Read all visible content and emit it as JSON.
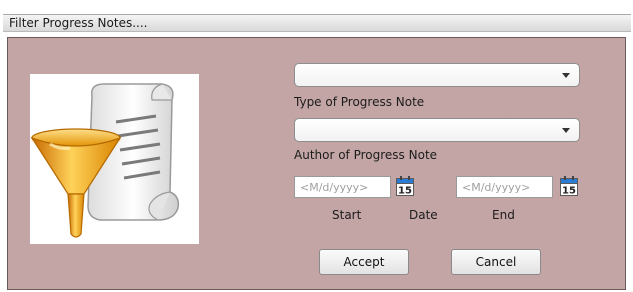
{
  "window": {
    "title": "Filter Progress Notes...."
  },
  "form": {
    "type_of_note": {
      "value": "",
      "label": "Type of Progress Note"
    },
    "author": {
      "value": "",
      "label": "Author of Progress Note"
    },
    "start_date": {
      "placeholder": "<M/d/yyyy>",
      "calendar_day": "15"
    },
    "end_date": {
      "placeholder": "<M/d/yyyy>",
      "calendar_day": "15"
    },
    "date_labels": {
      "start": "Start",
      "middle": "Date",
      "end": "End"
    }
  },
  "buttons": {
    "accept": "Accept",
    "cancel": "Cancel"
  },
  "icons": {
    "illustration": "funnel-scroll-icon",
    "combo_arrow": "chevron-down-icon",
    "calendar": "calendar-icon"
  },
  "colors": {
    "panel_background": "#c3a5a5",
    "funnel": "#f0a020",
    "calendar_accent": "#2a7bd6"
  }
}
